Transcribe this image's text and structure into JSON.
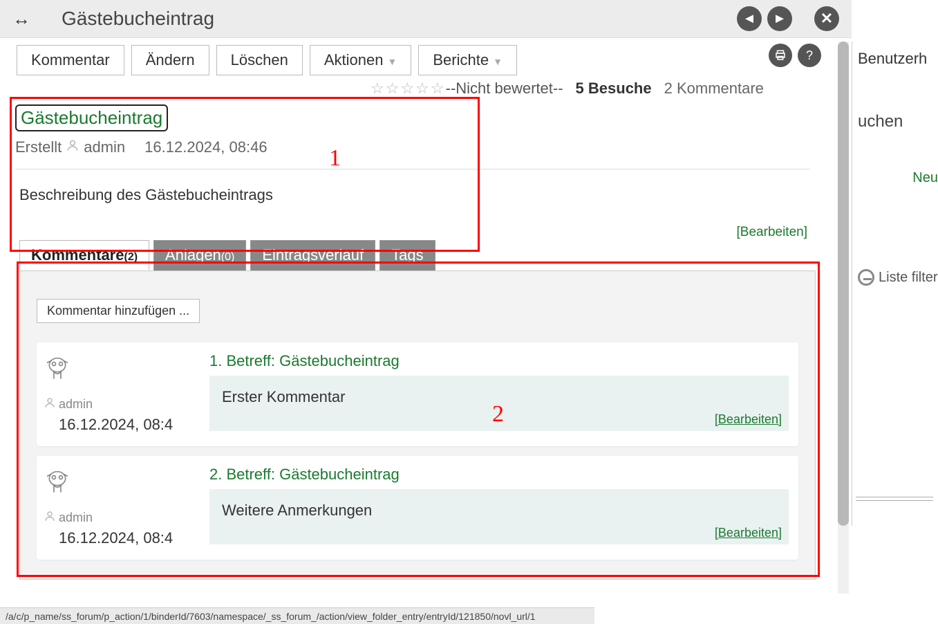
{
  "titlebar": {
    "title": "Gästebucheintrag"
  },
  "toolbar": {
    "kommentar": "Kommentar",
    "aendern": "Ändern",
    "loeschen": "Löschen",
    "aktionen": "Aktionen",
    "berichte": "Berichte"
  },
  "stats": {
    "notrated": "--Nicht bewertet--",
    "visits": "5 Besuche",
    "comments": "2 Kommentare"
  },
  "entry": {
    "title": "Gästebucheintrag",
    "created_label": "Erstellt",
    "author": "admin",
    "date": "16.12.2024, 08:46",
    "description": "Beschreibung des Gästebucheintrags",
    "edit_label": "[Bearbeiten]"
  },
  "tabs": {
    "kommentare_label": "Kommentare",
    "kommentare_count": "(2)",
    "anlagen_label": "Anlagen",
    "anlagen_count": "(0)",
    "verlauf": "Eintragsverlauf",
    "tags": "Tags"
  },
  "addcomment": "Kommentar hinzufügen ...",
  "comments_list": [
    {
      "author": "admin",
      "date": "16.12.2024, 08:4",
      "title": "1. Betreff: Gästebucheintrag",
      "body": "Erster Kommentar",
      "edit": "[Bearbeiten]"
    },
    {
      "author": "admin",
      "date": "16.12.2024, 08:4",
      "title": "2. Betreff: Gästebucheintrag",
      "body": "Weitere Anmerkungen",
      "edit": "[Bearbeiten]"
    }
  ],
  "side": {
    "benutzer": "Benutzerh",
    "suchen": "uchen",
    "neu": "Neu",
    "filter": "Liste filter"
  },
  "markers": {
    "one": "1",
    "two": "2"
  },
  "statusbar": "/a/c/p_name/ss_forum/p_action/1/binderId/7603/namespace/_ss_forum_/action/view_folder_entry/entryId/121850/novl_url/1"
}
